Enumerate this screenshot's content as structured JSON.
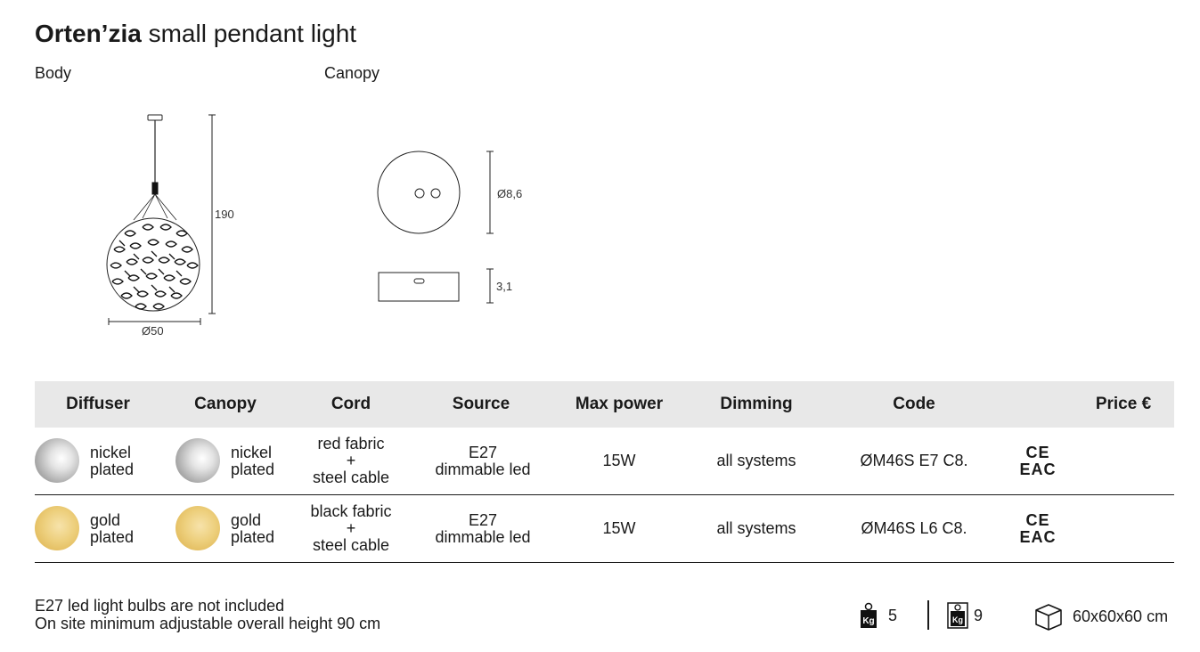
{
  "title": {
    "name": "Orten’zia",
    "subtitle": "small pendant light"
  },
  "labels": {
    "body": "Body",
    "canopy": "Canopy"
  },
  "dimensions": {
    "height": "190",
    "diameter": "Ø50",
    "canopy_diameter": "Ø8,6",
    "canopy_height": "3,1"
  },
  "table": {
    "headers": {
      "diffuser": "Diffuser",
      "canopy": "Canopy",
      "cord": "Cord",
      "source": "Source",
      "max_power": "Max power",
      "dimming": "Dimming",
      "code": "Code",
      "price": "Price €"
    },
    "rows": [
      {
        "diffuser_line1": "nickel",
        "diffuser_line2": "plated",
        "canopy_line1": "nickel",
        "canopy_line2": "plated",
        "cord_line1": "red fabric",
        "cord_line2": "+",
        "cord_line3": "steel cable",
        "source_line1": "E27",
        "source_line2": "dimmable led",
        "max_power": "15W",
        "dimming": "all systems",
        "code": "ØM46S E7 C8.",
        "cert": "CE EAC",
        "swatch": "nickel"
      },
      {
        "diffuser_line1": "gold",
        "diffuser_line2": "plated",
        "canopy_line1": "gold",
        "canopy_line2": "plated",
        "cord_line1": "black fabric",
        "cord_line2": "+",
        "cord_line3": "steel cable",
        "source_line1": "E27",
        "source_line2": "dimmable led",
        "max_power": "15W",
        "dimming": "all systems",
        "code": "ØM46S L6 C8.",
        "cert": "CE EAC",
        "swatch": "gold"
      }
    ]
  },
  "notes": {
    "line1": "E27 led light bulbs are not included",
    "line2": "On site minimum adjustable overall height 90 cm"
  },
  "shipping": {
    "net_weight": "5",
    "gross_weight": "9",
    "package_size": "60x60x60 cm",
    "weight_unit_icon": "Kg"
  },
  "colors": {
    "header_bg": "#e8e8e8",
    "nickel": "#b5b5b5",
    "gold": "#e8c66c"
  }
}
